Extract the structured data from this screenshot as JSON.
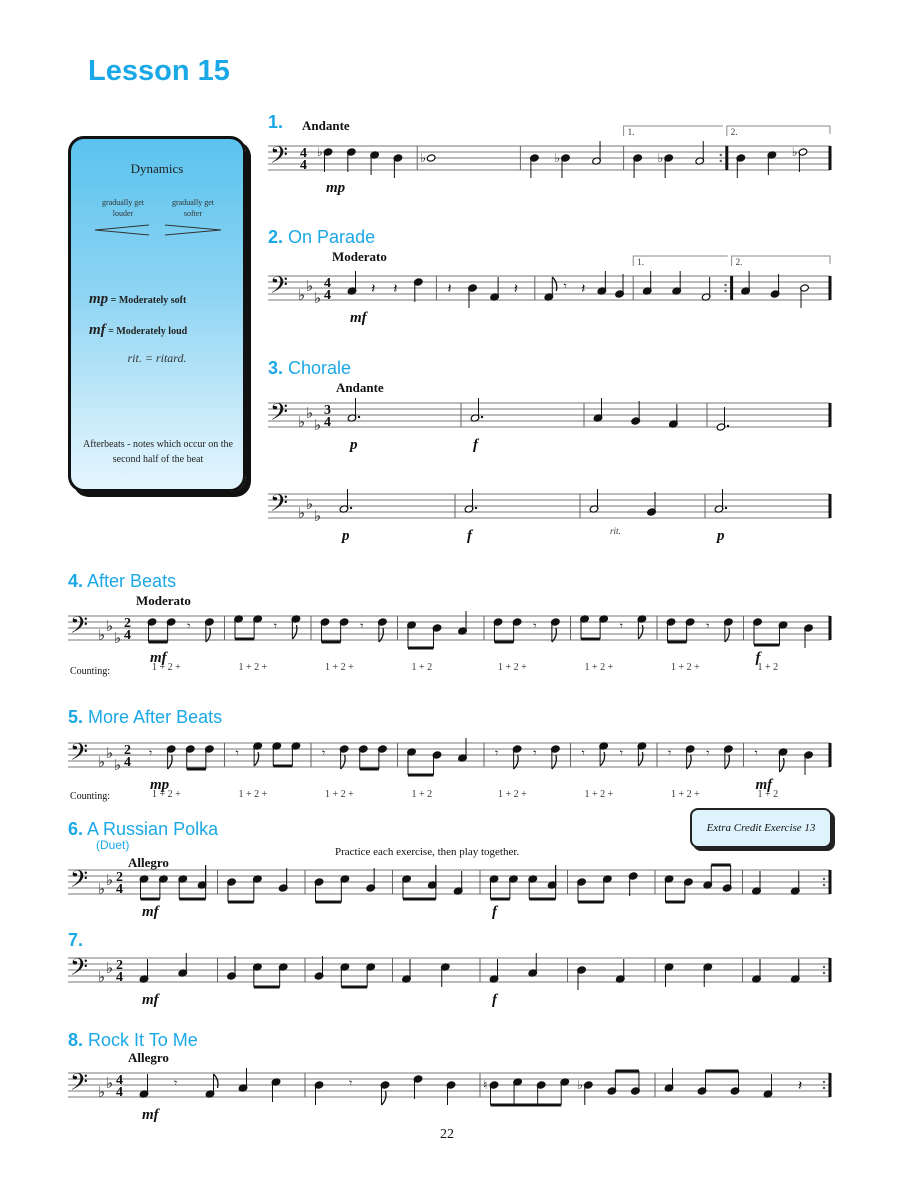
{
  "lesson_title": "Lesson 15",
  "infobox": {
    "heading": "Dynamics",
    "cresc_label": "gradually get louder",
    "decresc_label": "gradually get softer",
    "defs": [
      {
        "symbol": "mp",
        "meaning": "= Moderately soft"
      },
      {
        "symbol": "mf",
        "meaning": "= Moderately loud"
      }
    ],
    "rit": "rit.  =  ritard.",
    "afterbeats": "Afterbeats - notes which occur on the second half of the beat"
  },
  "extra_credit": "Extra Credit Exercise 13",
  "practice_note": "Practice each exercise, then play together.",
  "counting_label": "Counting:",
  "page_number": "22",
  "exercises": [
    {
      "num": "1.",
      "title": "",
      "tempo": "Andante",
      "key_flats": 0,
      "time": [
        "4",
        "4"
      ],
      "endings": [
        "1.",
        "2."
      ],
      "dynamics": [
        {
          "t": "mp",
          "m": 0
        }
      ],
      "measures": [
        [
          {
            "p": 6,
            "d": "q",
            "acc": "b"
          },
          {
            "p": 6,
            "d": "q"
          },
          {
            "p": 5,
            "d": "q"
          },
          {
            "p": 4,
            "d": "q"
          }
        ],
        [
          {
            "p": 4,
            "d": "w",
            "acc": "b"
          }
        ],
        [
          {
            "p": 4,
            "d": "q"
          },
          {
            "p": 4,
            "d": "q",
            "acc": "b"
          },
          {
            "p": 3,
            "d": "h"
          }
        ],
        [
          {
            "p": 4,
            "d": "q"
          },
          {
            "p": 4,
            "d": "q",
            "acc": "b"
          },
          {
            "p": 3,
            "d": "h"
          }
        ],
        [
          {
            "p": 4,
            "d": "q"
          },
          {
            "p": 5,
            "d": "q"
          },
          {
            "p": 6,
            "d": "h",
            "acc": "b"
          }
        ]
      ]
    },
    {
      "num": "2.",
      "title": "On Parade",
      "tempo": "Moderato",
      "key_flats": 3,
      "time": [
        "4",
        "4"
      ],
      "endings": [
        "1.",
        "2."
      ],
      "dynamics": [
        {
          "t": "mf",
          "m": 0
        }
      ],
      "measures": [
        [
          {
            "p": 3,
            "d": "q"
          },
          {
            "d": "qr"
          },
          {
            "d": "qr"
          },
          {
            "p": 6,
            "d": "q"
          }
        ],
        [
          {
            "d": "qr"
          },
          {
            "p": 4,
            "d": "q"
          },
          {
            "p": 1,
            "d": "q"
          },
          {
            "d": "qr"
          }
        ],
        [
          {
            "p": 1,
            "d": "e"
          },
          {
            "d": "er"
          },
          {
            "d": "qr"
          },
          {
            "p": 3,
            "d": "q"
          },
          {
            "p": 2,
            "d": "q"
          }
        ],
        [
          {
            "p": 3,
            "d": "q"
          },
          {
            "p": 3,
            "d": "q"
          },
          {
            "p": 1,
            "d": "h"
          }
        ],
        [
          {
            "p": 3,
            "d": "q"
          },
          {
            "p": 2,
            "d": "q"
          },
          {
            "p": 4,
            "d": "h"
          }
        ]
      ]
    },
    {
      "num": "3.",
      "title": "Chorale",
      "tempo": "Andante",
      "key_flats": 3,
      "time": [
        "3",
        "4"
      ],
      "dynamics": [
        {
          "t": "p",
          "m": 0
        },
        {
          "t": "f",
          "m": 1
        }
      ],
      "measures": [
        [
          {
            "p": 3,
            "d": "hd"
          }
        ],
        [
          {
            "p": 3,
            "d": "hd"
          }
        ],
        [
          {
            "p": 3,
            "d": "q"
          },
          {
            "p": 2,
            "d": "q"
          },
          {
            "p": 1,
            "d": "q"
          }
        ],
        [
          {
            "p": 0,
            "d": "hd"
          }
        ]
      ],
      "line2": {
        "dynamics": [
          {
            "t": "p",
            "m": 0
          },
          {
            "t": "f",
            "m": 1
          },
          {
            "t": "p",
            "m": 3
          }
        ],
        "rit": "rit.",
        "measures": [
          [
            {
              "p": 3,
              "d": "hd"
            }
          ],
          [
            {
              "p": 3,
              "d": "hd"
            }
          ],
          [
            {
              "p": 3,
              "d": "h"
            },
            {
              "p": 2,
              "d": "q"
            }
          ],
          [
            {
              "p": 3,
              "d": "hd"
            }
          ]
        ]
      }
    },
    {
      "num": "4.",
      "title": "After Beats",
      "tempo": "Moderato",
      "key_flats": 3,
      "time": [
        "2",
        "4"
      ],
      "dynamics": [
        {
          "t": "mf",
          "m": 0
        },
        {
          "t": "f",
          "m": 7
        }
      ],
      "counting": [
        "1 + 2 +",
        "1 + 2 +",
        "1 + 2 +",
        "1 + 2",
        "1 + 2 +",
        "1 + 2 +",
        "1 + 2 +",
        "1 + 2"
      ],
      "measures": [
        [
          {
            "p": 6,
            "d": "e",
            "beam": 1
          },
          {
            "p": 6,
            "d": "e",
            "beam": 1
          },
          {
            "d": "er"
          },
          {
            "p": 6,
            "d": "e"
          }
        ],
        [
          {
            "p": 7,
            "d": "e",
            "beam": 1
          },
          {
            "p": 7,
            "d": "e",
            "beam": 1
          },
          {
            "d": "er"
          },
          {
            "p": 7,
            "d": "e"
          }
        ],
        [
          {
            "p": 6,
            "d": "e",
            "beam": 1
          },
          {
            "p": 6,
            "d": "e",
            "beam": 1
          },
          {
            "d": "er"
          },
          {
            "p": 6,
            "d": "e"
          }
        ],
        [
          {
            "p": 5,
            "d": "e",
            "beam": 1
          },
          {
            "p": 4,
            "d": "e",
            "beam": 1
          },
          {
            "p": 3,
            "d": "q"
          }
        ],
        [
          {
            "p": 6,
            "d": "e",
            "beam": 1
          },
          {
            "p": 6,
            "d": "e",
            "beam": 1
          },
          {
            "d": "er"
          },
          {
            "p": 6,
            "d": "e"
          }
        ],
        [
          {
            "p": 7,
            "d": "e",
            "beam": 1
          },
          {
            "p": 7,
            "d": "e",
            "beam": 1
          },
          {
            "d": "er"
          },
          {
            "p": 7,
            "d": "e"
          }
        ],
        [
          {
            "p": 6,
            "d": "e",
            "beam": 1
          },
          {
            "p": 6,
            "d": "e",
            "beam": 1
          },
          {
            "d": "er"
          },
          {
            "p": 6,
            "d": "e"
          }
        ],
        [
          {
            "p": 6,
            "d": "e",
            "beam": 1
          },
          {
            "p": 5,
            "d": "e",
            "beam": 1
          },
          {
            "p": 4,
            "d": "q"
          }
        ]
      ]
    },
    {
      "num": "5.",
      "title": "More After Beats",
      "tempo": "",
      "key_flats": 3,
      "time": [
        "2",
        "4"
      ],
      "dynamics": [
        {
          "t": "mp",
          "m": 0
        },
        {
          "t": "mf",
          "m": 7
        }
      ],
      "counting": [
        "1 + 2 +",
        "1 + 2 +",
        "1 + 2 +",
        "1 + 2",
        "1 + 2 +",
        "1 + 2 +",
        "1 + 2 +",
        "1 + 2"
      ],
      "measures": [
        [
          {
            "d": "er"
          },
          {
            "p": 6,
            "d": "e"
          },
          {
            "p": 6,
            "d": "e",
            "beam": 1
          },
          {
            "p": 6,
            "d": "e",
            "beam": 1
          }
        ],
        [
          {
            "d": "er"
          },
          {
            "p": 7,
            "d": "e"
          },
          {
            "p": 7,
            "d": "e",
            "beam": 1
          },
          {
            "p": 7,
            "d": "e",
            "beam": 1
          }
        ],
        [
          {
            "d": "er"
          },
          {
            "p": 6,
            "d": "e"
          },
          {
            "p": 6,
            "d": "e",
            "beam": 1
          },
          {
            "p": 6,
            "d": "e",
            "beam": 1
          }
        ],
        [
          {
            "p": 5,
            "d": "e",
            "beam": 1
          },
          {
            "p": 4,
            "d": "e",
            "beam": 1
          },
          {
            "p": 3,
            "d": "q"
          }
        ],
        [
          {
            "d": "er"
          },
          {
            "p": 6,
            "d": "e"
          },
          {
            "d": "er"
          },
          {
            "p": 6,
            "d": "e"
          }
        ],
        [
          {
            "d": "er"
          },
          {
            "p": 7,
            "d": "e"
          },
          {
            "d": "er"
          },
          {
            "p": 7,
            "d": "e"
          }
        ],
        [
          {
            "d": "er"
          },
          {
            "p": 6,
            "d": "e"
          },
          {
            "d": "er"
          },
          {
            "p": 6,
            "d": "e"
          }
        ],
        [
          {
            "d": "er"
          },
          {
            "p": 5,
            "d": "e"
          },
          {
            "p": 4,
            "d": "q"
          }
        ]
      ]
    },
    {
      "num": "6.",
      "title": "A Russian Polka",
      "subtitle": "(Duet)",
      "tempo": "Allegro",
      "key_flats": 2,
      "time": [
        "2",
        "4"
      ],
      "dynamics": [
        {
          "t": "mf",
          "m": 0
        },
        {
          "t": "f",
          "m": 4
        }
      ],
      "measures": [
        [
          {
            "p": 5,
            "d": "e",
            "beam": 1
          },
          {
            "p": 5,
            "d": "e",
            "beam": 1
          },
          {
            "p": 5,
            "d": "e",
            "beam": 2
          },
          {
            "p": 3,
            "d": "e",
            "beam": 2
          }
        ],
        [
          {
            "p": 4,
            "d": "e",
            "beam": 1
          },
          {
            "p": 5,
            "d": "e",
            "beam": 1
          },
          {
            "p": 2,
            "d": "q"
          }
        ],
        [
          {
            "p": 4,
            "d": "e",
            "beam": 1
          },
          {
            "p": 5,
            "d": "e",
            "beam": 1
          },
          {
            "p": 2,
            "d": "q"
          }
        ],
        [
          {
            "p": 5,
            "d": "e",
            "beam": 1
          },
          {
            "p": 3,
            "d": "e",
            "beam": 1
          },
          {
            "p": 1,
            "d": "q"
          }
        ],
        [
          {
            "p": 5,
            "d": "e",
            "beam": 1
          },
          {
            "p": 5,
            "d": "e",
            "beam": 1
          },
          {
            "p": 5,
            "d": "e",
            "beam": 2
          },
          {
            "p": 3,
            "d": "e",
            "beam": 2
          }
        ],
        [
          {
            "p": 4,
            "d": "e",
            "beam": 1
          },
          {
            "p": 5,
            "d": "e",
            "beam": 1
          },
          {
            "p": 6,
            "d": "q"
          }
        ],
        [
          {
            "p": 5,
            "d": "e",
            "beam": 1
          },
          {
            "p": 4,
            "d": "e",
            "beam": 1
          },
          {
            "p": 3,
            "d": "e",
            "beam": 2
          },
          {
            "p": 2,
            "d": "e",
            "beam": 2
          }
        ],
        [
          {
            "p": 1,
            "d": "q"
          },
          {
            "p": 1,
            "d": "q"
          }
        ]
      ]
    },
    {
      "num": "7.",
      "title": "",
      "tempo": "",
      "key_flats": 2,
      "time": [
        "2",
        "4"
      ],
      "dynamics": [
        {
          "t": "mf",
          "m": 0
        },
        {
          "t": "f",
          "m": 4
        }
      ],
      "measures": [
        [
          {
            "p": 1,
            "d": "q"
          },
          {
            "p": 3,
            "d": "q"
          }
        ],
        [
          {
            "p": 2,
            "d": "q"
          },
          {
            "p": 5,
            "d": "e",
            "beam": 1
          },
          {
            "p": 5,
            "d": "e",
            "beam": 1
          }
        ],
        [
          {
            "p": 2,
            "d": "q"
          },
          {
            "p": 5,
            "d": "e",
            "beam": 1
          },
          {
            "p": 5,
            "d": "e",
            "beam": 1
          }
        ],
        [
          {
            "p": 1,
            "d": "q"
          },
          {
            "p": 5,
            "d": "q"
          }
        ],
        [
          {
            "p": 1,
            "d": "q"
          },
          {
            "p": 3,
            "d": "q"
          }
        ],
        [
          {
            "p": 4,
            "d": "q"
          },
          {
            "p": 1,
            "d": "q"
          }
        ],
        [
          {
            "p": 5,
            "d": "q"
          },
          {
            "p": 5,
            "d": "q"
          }
        ],
        [
          {
            "p": 1,
            "d": "q"
          },
          {
            "p": 1,
            "d": "q"
          }
        ]
      ]
    },
    {
      "num": "8.",
      "title": "Rock It To Me",
      "tempo": "Allegro",
      "key_flats": 2,
      "time": [
        "4",
        "4"
      ],
      "dynamics": [
        {
          "t": "mf",
          "m": 0
        }
      ],
      "measures": [
        [
          {
            "p": 1,
            "d": "q"
          },
          {
            "d": "er"
          },
          {
            "p": 1,
            "d": "e"
          },
          {
            "p": 3,
            "d": "q"
          },
          {
            "p": 5,
            "d": "q"
          }
        ],
        [
          {
            "p": 4,
            "d": "q"
          },
          {
            "d": "er"
          },
          {
            "p": 4,
            "d": "e"
          },
          {
            "p": 6,
            "d": "q"
          },
          {
            "p": 4,
            "d": "q"
          }
        ],
        [
          {
            "p": 4,
            "d": "e",
            "beam": 1,
            "acc": "n"
          },
          {
            "p": 5,
            "d": "e",
            "beam": 1
          },
          {
            "p": 4,
            "d": "e",
            "beam": 1
          },
          {
            "p": 5,
            "d": "e",
            "beam": 1
          },
          {
            "p": 4,
            "d": "q",
            "acc": "b"
          },
          {
            "p": 2,
            "d": "e",
            "beam": 2
          },
          {
            "p": 2,
            "d": "e",
            "beam": 2
          }
        ],
        [
          {
            "p": 3,
            "d": "q"
          },
          {
            "p": 2,
            "d": "e",
            "beam": 1
          },
          {
            "p": 2,
            "d": "e",
            "beam": 1
          },
          {
            "p": 1,
            "d": "q"
          },
          {
            "d": "qr"
          }
        ]
      ]
    }
  ]
}
